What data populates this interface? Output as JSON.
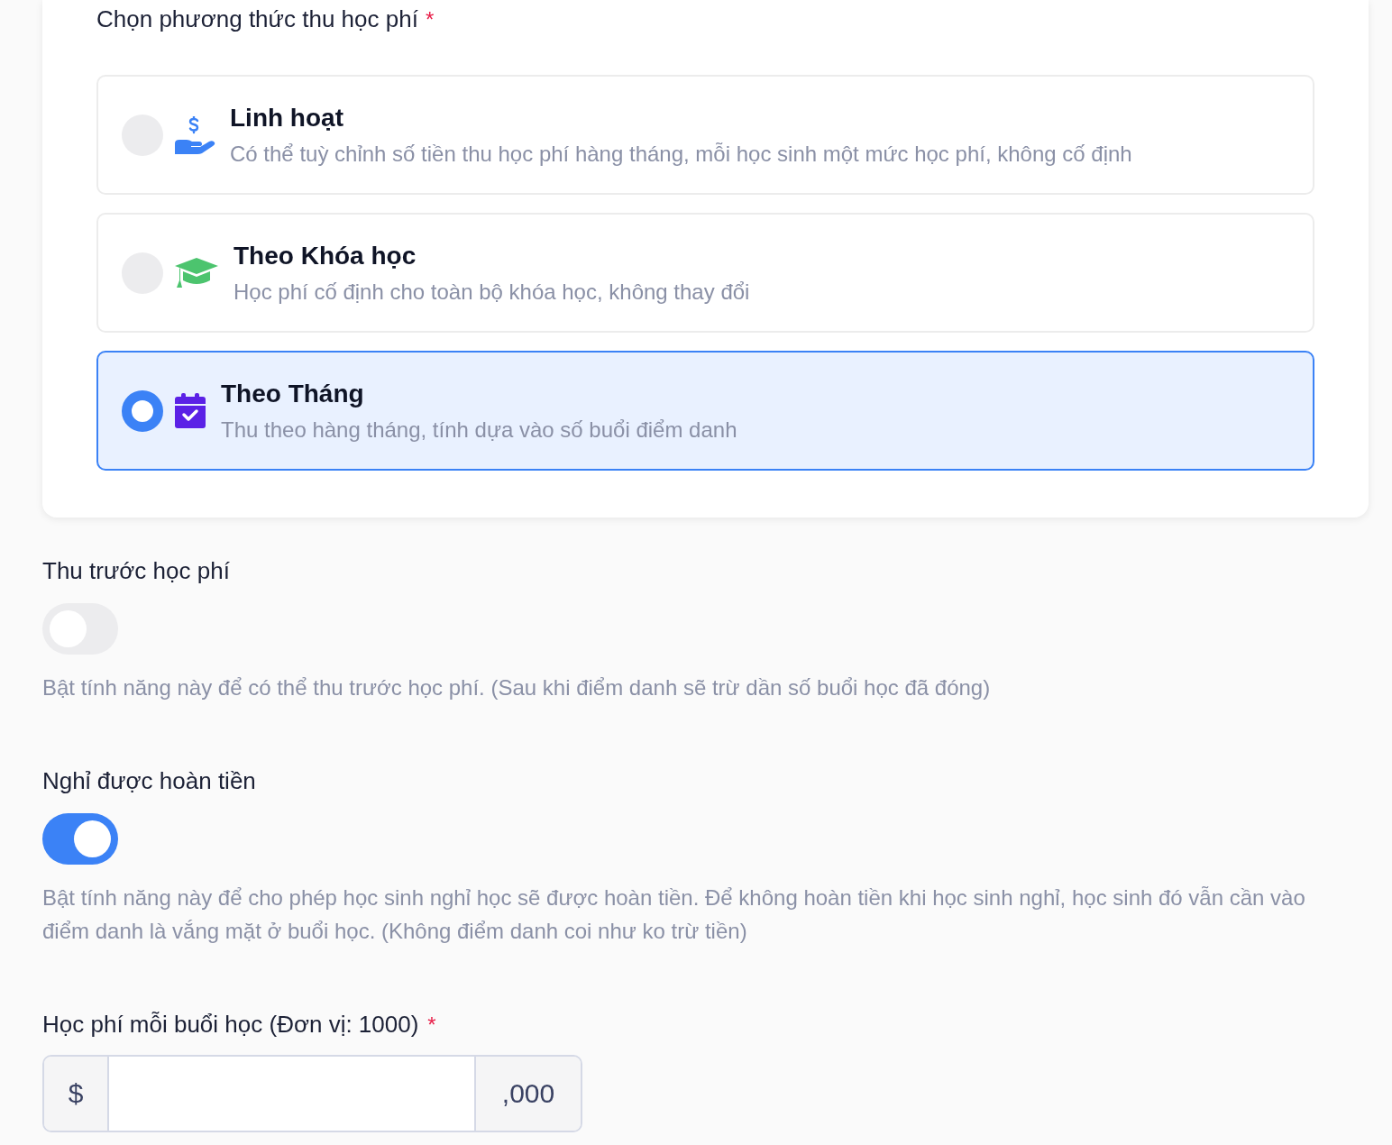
{
  "payment_method": {
    "label": "Chọn phương thức thu học phí",
    "required_mark": "*",
    "options": [
      {
        "title": "Linh hoạt",
        "description": "Có thể tuỳ chỉnh số tiền thu học phí hàng tháng, mỗi học sinh một mức học phí, không cố định",
        "selected": false
      },
      {
        "title": "Theo Khóa học",
        "description": "Học phí cố định cho toàn bộ khóa học, không thay đổi",
        "selected": false
      },
      {
        "title": "Theo Tháng",
        "description": "Thu theo hàng tháng, tính dựa vào số buổi điểm danh",
        "selected": true
      }
    ]
  },
  "settings": [
    {
      "label": "Thu trước học phí",
      "on": false,
      "hint": "Bật tính năng này để có thể thu trước học phí. (Sau khi điểm danh sẽ trừ dần số buổi học đã đóng)"
    },
    {
      "label": "Nghỉ được hoàn tiền",
      "on": true,
      "hint": "Bật tính năng này để cho phép học sinh nghỉ học sẽ được hoàn tiền. Để không hoàn tiền khi học sinh nghỉ, học sinh đó vẫn cần vào điểm danh là vắng mặt ở buổi học. (Không điểm danh coi như ko trừ tiền)"
    }
  ],
  "fee_field": {
    "label": "Học phí mỗi buổi học (Đơn vị: 1000)",
    "required_mark": "*",
    "prefix": "$",
    "suffix": ",000"
  }
}
